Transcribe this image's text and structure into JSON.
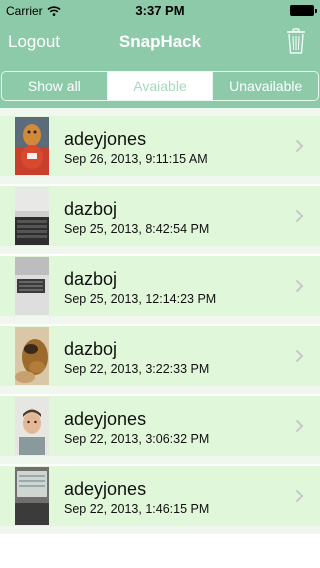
{
  "status_bar": {
    "carrier": "Carrier",
    "time": "3:37 PM"
  },
  "nav": {
    "left_label": "Logout",
    "title": "SnapHack",
    "right_icon": "trash-icon"
  },
  "segments": [
    {
      "label": "Show all",
      "selected": false
    },
    {
      "label": "Avaiable",
      "selected": true
    },
    {
      "label": "Unavailable",
      "selected": false
    }
  ],
  "colors": {
    "nav_green": "#8ccaa9",
    "row_green": "#e0f7d9",
    "chevron": "#c7c7cc"
  },
  "items": [
    {
      "name": "adeyjones",
      "date": "Sep 26, 2013, 9:11:15 AM",
      "thumb": "mascot-photo"
    },
    {
      "name": "dazboj",
      "date": "Sep 25, 2013, 8:42:54 PM",
      "thumb": "keyboard-photo"
    },
    {
      "name": "dazboj",
      "date": "Sep 25, 2013, 12:14:23 PM",
      "thumb": "laptop-photo"
    },
    {
      "name": "dazboj",
      "date": "Sep 22, 2013, 3:22:33 PM",
      "thumb": "plush-toy-photo"
    },
    {
      "name": "adeyjones",
      "date": "Sep 22, 2013, 3:06:32 PM",
      "thumb": "selfie-photo"
    },
    {
      "name": "adeyjones",
      "date": "Sep 22, 2013, 1:46:15 PM",
      "thumb": "screen-photo"
    }
  ]
}
